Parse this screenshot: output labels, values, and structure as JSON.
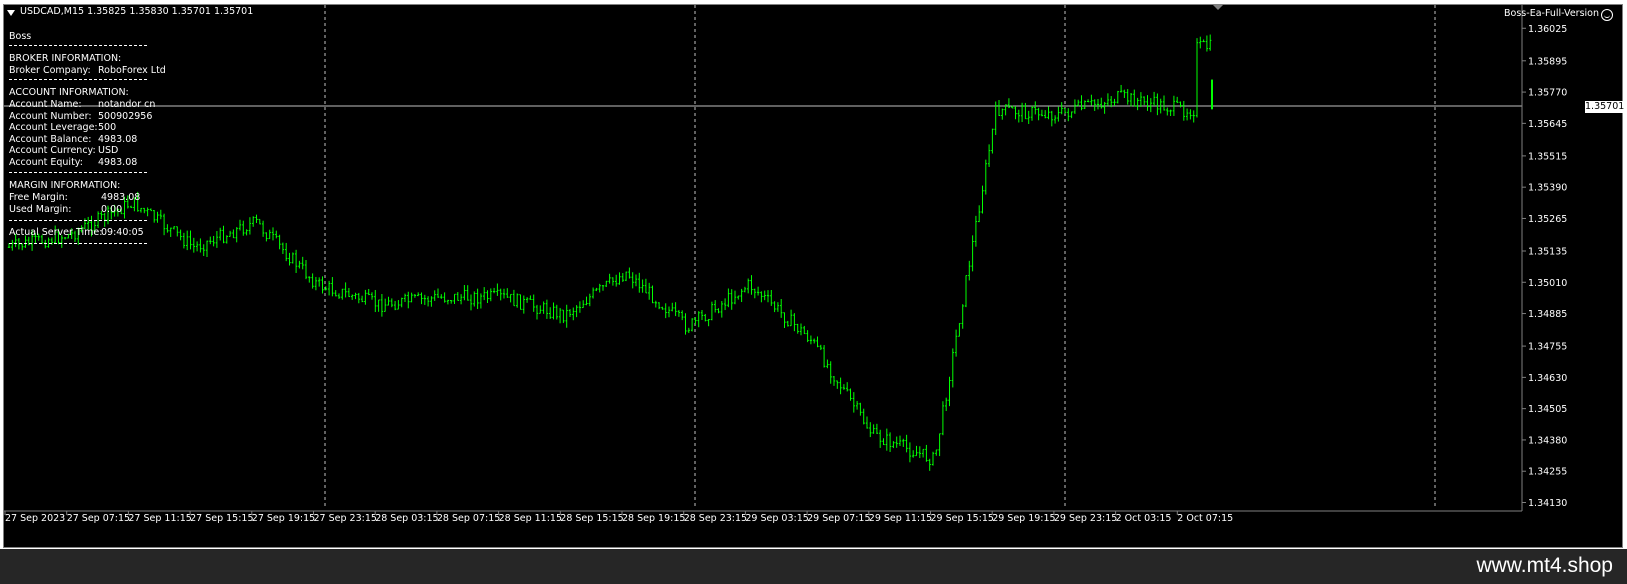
{
  "chart": {
    "header": "USDCAD,M15  1.35825 1.35830 1.35701 1.35701",
    "ea_label": "Boss-Ea-Full-Version",
    "current_price_label": "1.35701",
    "colors": {
      "background": "#000000",
      "candles": "#00ff00",
      "grid": "#c0c0c0",
      "axis_text": "#ffffff"
    },
    "period_separator_labels": [
      "27 Sep 23:15",
      "28 Sep 23:15",
      "29 Sep 23:15",
      "2 Oct 07:15"
    ]
  },
  "info_panel": {
    "title": "Boss",
    "broker_section": "BROKER INFORMATION:",
    "broker_company_label": "Broker Company:",
    "broker_company_value": "RoboForex Ltd",
    "account_section": "ACCOUNT INFORMATION:",
    "account_rows": [
      {
        "label": "Account Name:",
        "value": "notandor cn"
      },
      {
        "label": "Account Number:",
        "value": "500902956"
      },
      {
        "label": "Account Leverage:",
        "value": "500"
      },
      {
        "label": "Account Balance:",
        "value": "4983.08"
      },
      {
        "label": "Account Currency:",
        "value": "USD"
      },
      {
        "label": "Account Equity:",
        "value": "4983.08"
      }
    ],
    "margin_section": "MARGIN INFORMATION:",
    "margin_rows": [
      {
        "label": "Free Margin:",
        "value": "4983.08"
      },
      {
        "label": "Used Margin:",
        "value": "0.00"
      }
    ],
    "server_time_label": "Actual Server Time:",
    "server_time_value": "09:40:05"
  },
  "watermark": "www.mt4.shop",
  "chart_data": {
    "type": "candlestick",
    "symbol": "USDCAD",
    "timeframe": "M15",
    "y_ticks": [
      "1.36025",
      "1.35895",
      "1.35770",
      "1.35645",
      "1.35515",
      "1.35390",
      "1.35265",
      "1.35135",
      "1.35010",
      "1.34885",
      "1.34755",
      "1.34630",
      "1.34505",
      "1.34380",
      "1.34255",
      "1.34130"
    ],
    "ylim": [
      1.3412,
      1.3609
    ],
    "x_ticks": [
      "27 Sep 2023",
      "27 Sep 07:15",
      "27 Sep 11:15",
      "27 Sep 15:15",
      "27 Sep 19:15",
      "27 Sep 23:15",
      "28 Sep 03:15",
      "28 Sep 07:15",
      "28 Sep 11:15",
      "28 Sep 15:15",
      "28 Sep 19:15",
      "28 Sep 23:15",
      "29 Sep 03:15",
      "29 Sep 07:15",
      "29 Sep 11:15",
      "29 Sep 15:15",
      "29 Sep 19:15",
      "29 Sep 23:15",
      "2 Oct 03:15",
      "2 Oct 07:15"
    ],
    "current_price": 1.35701,
    "close_path": [
      {
        "t": "27 Sep 2023",
        "price": 1.3515
      },
      {
        "t": "27 Sep 07:15",
        "price": 1.352
      },
      {
        "t": "27 Sep 11:15",
        "price": 1.3533
      },
      {
        "t": "27 Sep 15:15",
        "price": 1.3515
      },
      {
        "t": "27 Sep 19:15",
        "price": 1.3525
      },
      {
        "t": "27 Sep 23:15",
        "price": 1.35
      },
      {
        "t": "28 Sep 03:15",
        "price": 1.3492
      },
      {
        "t": "28 Sep 07:15",
        "price": 1.3495
      },
      {
        "t": "28 Sep 11:15",
        "price": 1.3495
      },
      {
        "t": "28 Sep 15:15",
        "price": 1.3488
      },
      {
        "t": "28 Sep 19:15",
        "price": 1.3505
      },
      {
        "t": "28 Sep 23:15",
        "price": 1.3483
      },
      {
        "t": "29 Sep 03:15",
        "price": 1.35
      },
      {
        "t": "29 Sep 07:15",
        "price": 1.3478
      },
      {
        "t": "29 Sep 11:15",
        "price": 1.344
      },
      {
        "t": "29 Sep 15:15",
        "price": 1.343
      },
      {
        "t": "29 Sep 19:15",
        "price": 1.357
      },
      {
        "t": "29 Sep 23:15",
        "price": 1.3568
      },
      {
        "t": "2 Oct 03:15",
        "price": 1.3575
      },
      {
        "t": "2 Oct 07:15",
        "price": 1.357
      }
    ]
  }
}
